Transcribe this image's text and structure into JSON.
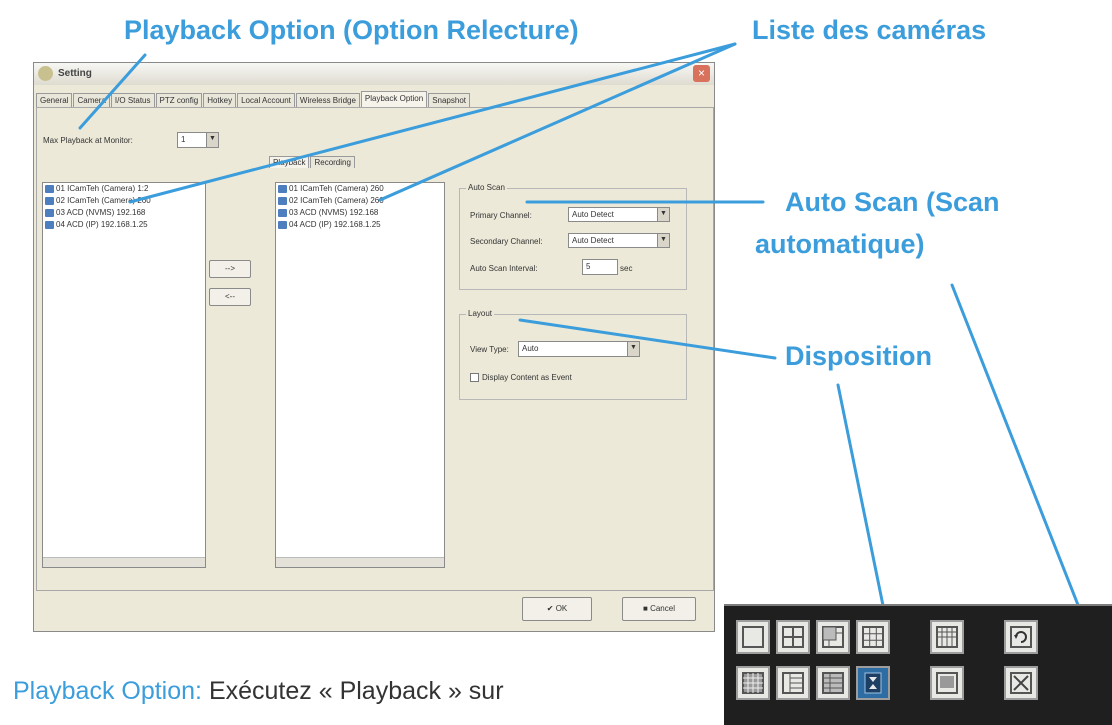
{
  "callouts": {
    "playback_option": "Playback Option (Option Relecture)",
    "camera_list": "Liste des caméras",
    "auto_scan_line1": "Auto Scan (Scan",
    "auto_scan_line2": "automatique)",
    "layout": "Disposition"
  },
  "colors": {
    "accent": "#3b9ddb",
    "dialog_bg": "#ece9d8",
    "toolbar_bg": "#1f1f1f",
    "selected_button": "#2e6da4"
  },
  "dialog": {
    "title": "Setting",
    "close_glyph": "×",
    "tabs": [
      {
        "label": "General"
      },
      {
        "label": "Camera"
      },
      {
        "label": "I/O Status"
      },
      {
        "label": "PTZ config"
      },
      {
        "label": "Hotkey"
      },
      {
        "label": "Local Account"
      },
      {
        "label": "Wireless Bridge"
      },
      {
        "label": "Playback Option"
      },
      {
        "label": "Snapshot"
      }
    ],
    "active_tab": "Playback Option",
    "max_playback": {
      "label": "Max Playback at Monitor:",
      "value": "1"
    },
    "inner_tabs": [
      {
        "label": "Playback"
      },
      {
        "label": "Recording"
      }
    ],
    "left_list": [
      {
        "label": "01 ICamTeh (Camera) 1:2"
      },
      {
        "label": "02 ICamTeh (Camera) 260"
      },
      {
        "label": "03 ACD (NVMS) 192.168"
      },
      {
        "label": "04 ACD (IP) 192.168.1.25"
      }
    ],
    "right_list": [
      {
        "label": "01 ICamTeh (Camera) 260"
      },
      {
        "label": "02 ICamTeh (Camera) 260"
      },
      {
        "label": "03 ACD (NVMS) 192.168"
      },
      {
        "label": "04 ACD (IP) 192.168.1.25"
      }
    ],
    "move_right_label": "-->",
    "move_left_label": "<--",
    "auto_scan": {
      "title": "Auto Scan",
      "primary_label": "Primary Channel:",
      "primary_value": "Auto Detect",
      "secondary_label": "Secondary Channel:",
      "secondary_value": "Auto Detect",
      "interval_label": "Auto Scan Interval:",
      "interval_value": "5",
      "interval_unit": "sec"
    },
    "layout": {
      "title": "Layout",
      "view_type_label": "View Type:",
      "view_type_value": "Auto",
      "display_label": "Display Content as Event"
    },
    "ok_label": "OK",
    "cancel_label": "Cancel"
  },
  "body_text": {
    "heading": "Playback Option:",
    "text": " Exécutez « Playback » sur"
  },
  "toolbar": {
    "row1_icons": [
      "layout-1x1-icon",
      "layout-2x2-icon",
      "layout-1plus5-icon",
      "layout-3x3-icon",
      "layout-4x4-icon",
      "auto-scan-icon"
    ],
    "row2_icons": [
      "layout-4x4-alt-icon",
      "layout-1plus7-icon",
      "layout-1plus12-icon",
      "layout-custom-selected-icon",
      "layout-full-icon",
      "full-screen-icon"
    ]
  }
}
